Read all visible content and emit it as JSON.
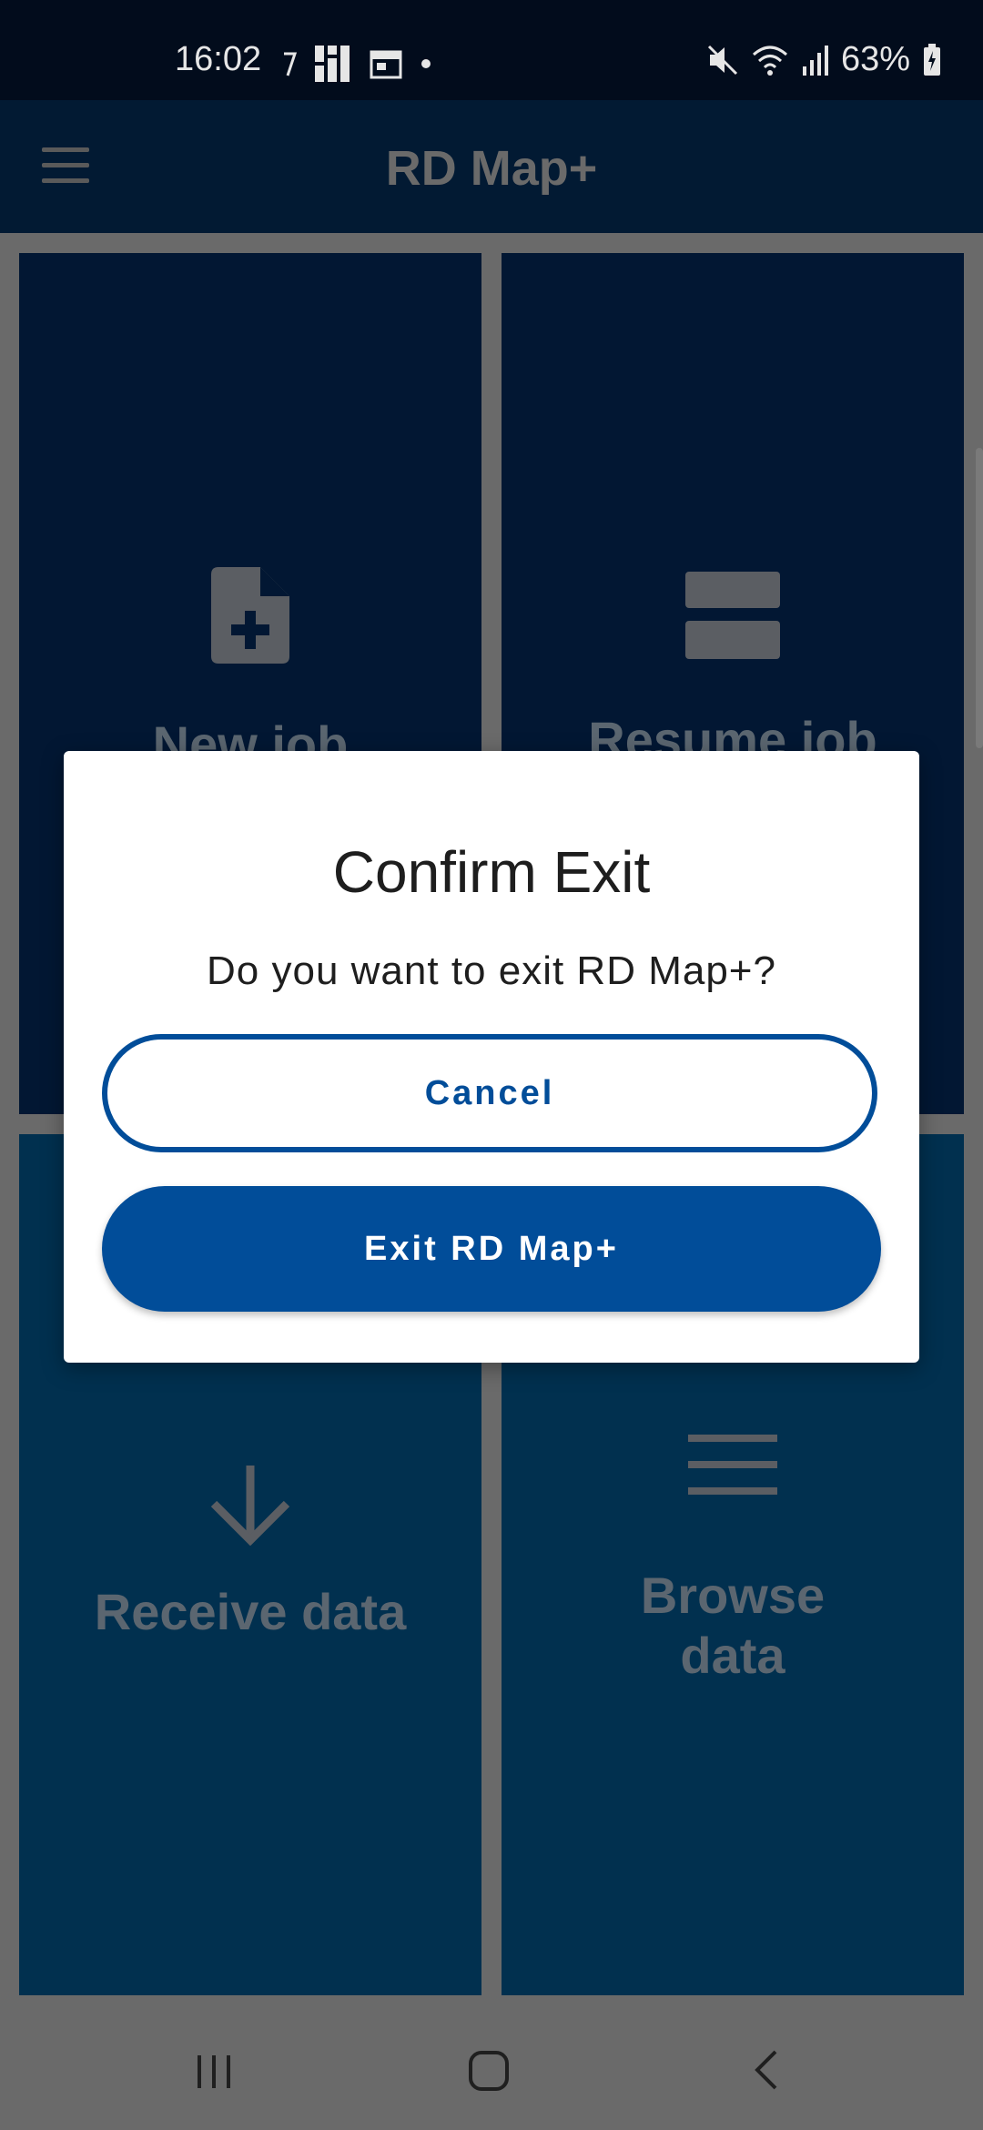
{
  "status_bar": {
    "time": "16:02",
    "battery": "63%"
  },
  "app_bar": {
    "title": "RD Map+",
    "menu_icon": "hamburger-menu-icon"
  },
  "tiles": [
    {
      "label": "New job",
      "icon": "file-plus-icon"
    },
    {
      "label": "Resume job",
      "icon": "list-icon"
    },
    {
      "label": "Receive data",
      "icon": "arrow-down-icon"
    },
    {
      "label": "Browse data",
      "label_lines": [
        "Browse",
        "data"
      ],
      "icon": "menu-lines-icon"
    }
  ],
  "dialog": {
    "title": "Confirm Exit",
    "message": "Do you want to exit RD Map+?",
    "cancel_label": "Cancel",
    "exit_label": "Exit RD Map+"
  },
  "colors": {
    "primary": "#014d99",
    "status_bar_bg": "#020c1c",
    "app_bar_bg": "#021a33",
    "tile_top_bg": "#021733",
    "tile_bottom_bg": "#01304f"
  }
}
